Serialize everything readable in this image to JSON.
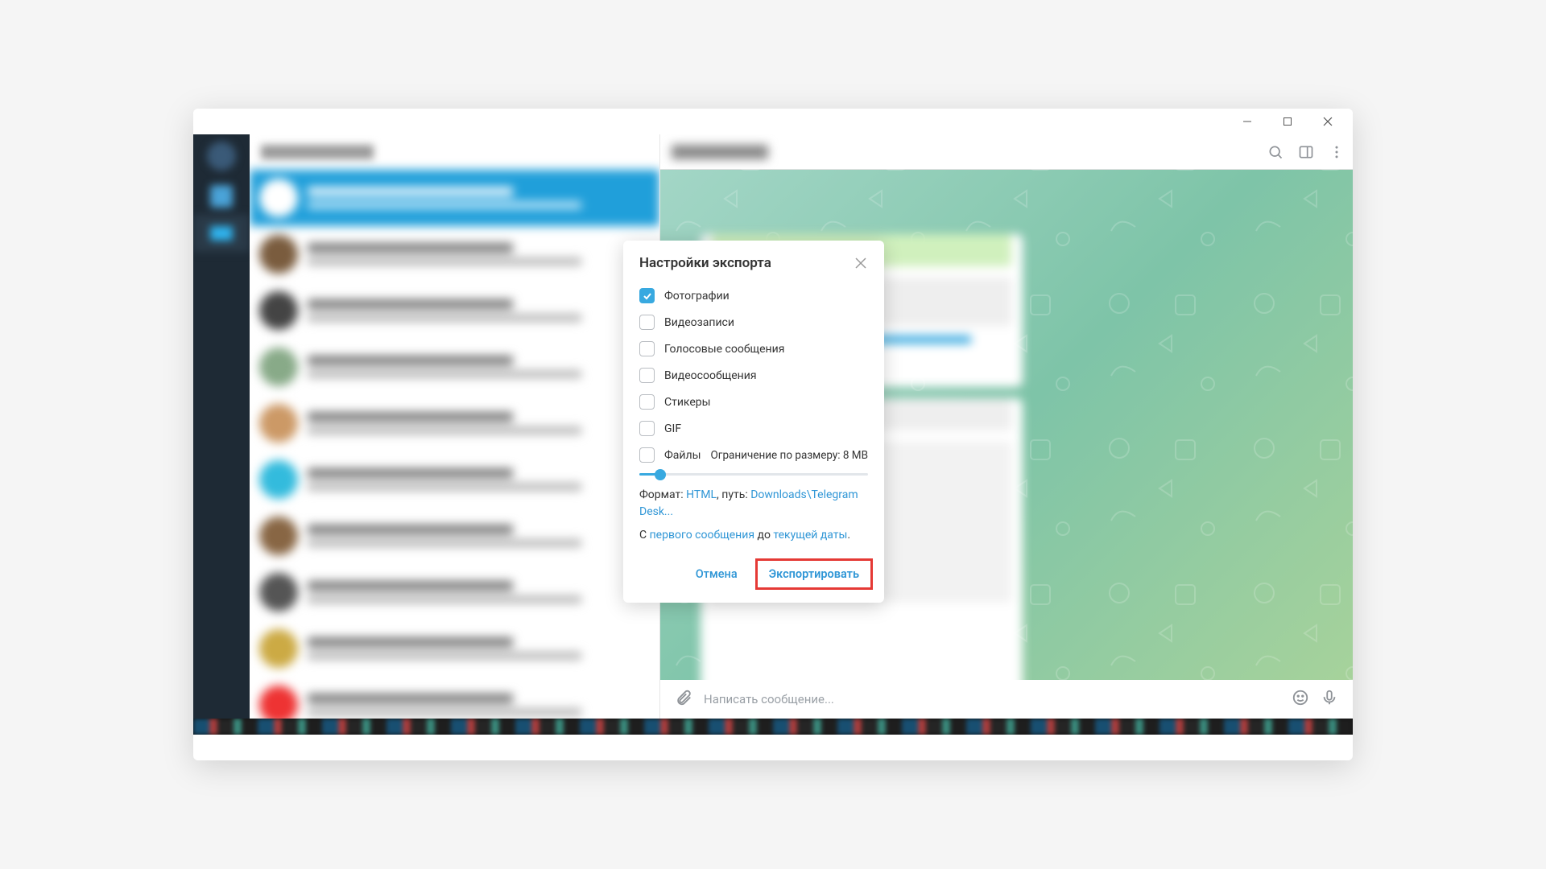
{
  "window": {
    "minimize": "−",
    "maximize": "▢",
    "close": "×"
  },
  "dialog": {
    "title": "Настройки экспорта",
    "options": {
      "photos": "Фотографии",
      "videos": "Видеозаписи",
      "voice": "Голосовые сообщения",
      "video_messages": "Видеосообщения",
      "stickers": "Стикеры",
      "gif": "GIF",
      "files": "Файлы"
    },
    "size_limit_label": "Ограничение по размеру: 8 MB",
    "format_prefix": "Формат: ",
    "format_value": "HTML",
    "path_prefix": ", путь: ",
    "path_value": "Downloads\\Telegram Desk...",
    "range_prefix": "С ",
    "range_from": "первого сообщения",
    "range_mid": " до ",
    "range_to": "текущей даты",
    "range_suffix": ".",
    "cancel": "Отмена",
    "export": "Экспортировать"
  },
  "compose": {
    "placeholder": "Написать сообщение..."
  }
}
